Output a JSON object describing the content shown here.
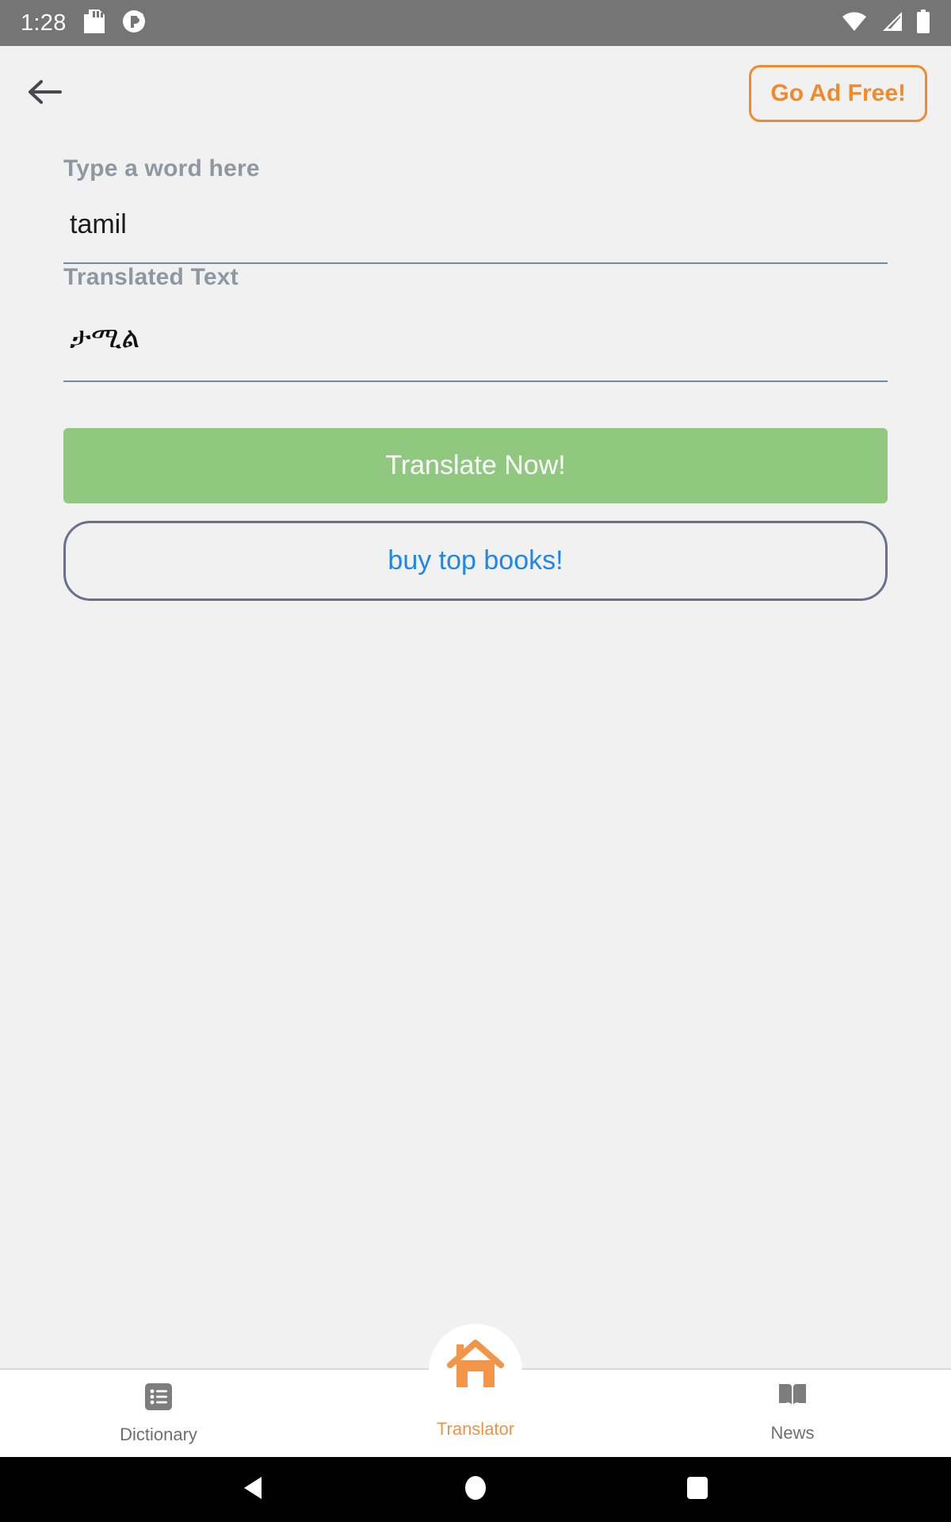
{
  "status_bar": {
    "time": "1:28",
    "icons": [
      "sd-card-icon",
      "app-notification-icon",
      "wifi-icon",
      "cellular-signal-icon",
      "battery-icon"
    ],
    "background_color": "#757575"
  },
  "app_bar": {
    "back_icon": "back-arrow-icon",
    "ad_free_label": "Go Ad Free!",
    "accent_color": "#ef8b2c"
  },
  "form": {
    "source_label": "Type a word here",
    "source_value": "tamil",
    "source_placeholder": "Type a word here",
    "target_label": "Translated Text",
    "target_value": "ታሚል",
    "target_placeholder": "Translated Text"
  },
  "actions": {
    "translate_label": "Translate Now!",
    "translate_color": "#90c87f",
    "books_label": "buy top books!",
    "books_text_color": "#1f87e5",
    "books_border_color": "#6b6f8f"
  },
  "bottom_nav": {
    "items": [
      {
        "label": "Dictionary",
        "icon": "list-icon",
        "active": "false"
      },
      {
        "label": "Translator",
        "icon": "home-icon",
        "active": "true"
      },
      {
        "label": "News",
        "icon": "book-icon",
        "active": "false"
      }
    ],
    "active_color": "#ef9343",
    "inactive_color": "#6f6f6f"
  },
  "android_nav": {
    "back": "back-triangle-icon",
    "home": "home-circle-icon",
    "recents": "recents-square-icon"
  }
}
